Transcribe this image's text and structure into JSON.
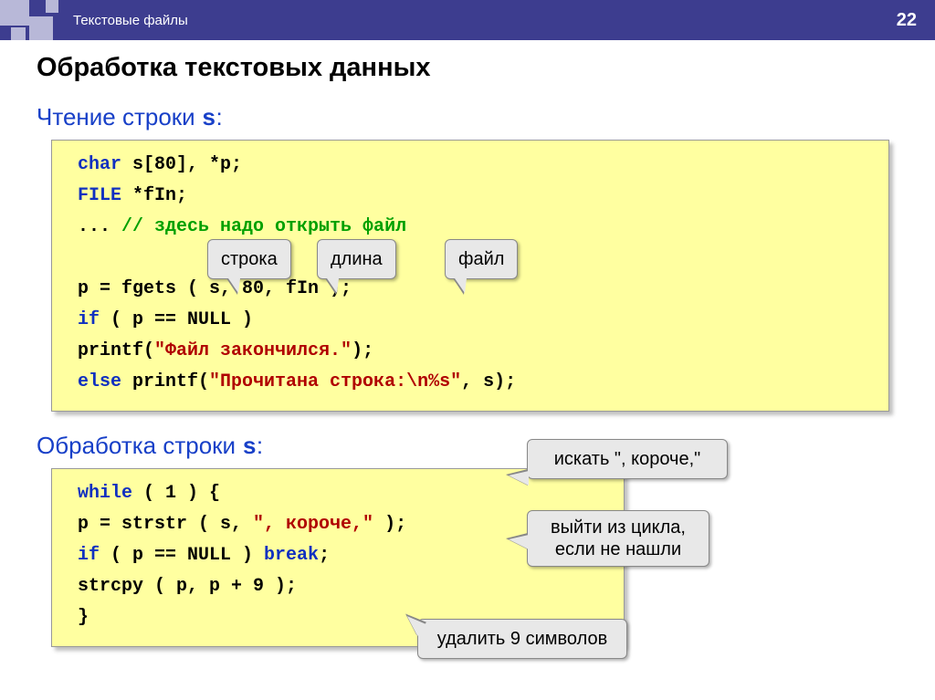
{
  "header": {
    "title": "Текстовые файлы",
    "page": "22"
  },
  "main_title": "Обработка текстовых данных",
  "section1": {
    "title_prefix": "Чтение строки ",
    "varname": "s",
    "title_suffix": ":",
    "code": {
      "l1a": "char",
      "l1b": " s[80], *p;",
      "l2a": "FILE",
      "l2b": " *fIn;",
      "l3a": "... ",
      "l3b": "// здесь надо открыть файл",
      "l4": "p = fgets ( s, 80, fIn );",
      "l5a": "if",
      "l5b": " ( p == NULL )",
      "l6a": "     printf(",
      "l6b": "\"Файл закончился.\"",
      "l6c": ");",
      "l7a": "else",
      "l7b": " printf(",
      "l7c": "\"Прочитана строка:\\n%s\"",
      "l7d": ", s);"
    },
    "callouts": {
      "stroka": "строка",
      "dlina": "длина",
      "file": "файл"
    }
  },
  "section2": {
    "title_prefix": "Обработка строки ",
    "varname": "s",
    "title_suffix": ":",
    "code": {
      "l1a": "while",
      "l1b": " ( 1 ) {",
      "l2a": "  p = strstr ( s, ",
      "l2b": "\", короче,\"",
      "l2c": " );",
      "l3a": "  if",
      "l3b": " ( p == NULL ) ",
      "l3c": "break",
      "l3d": ";",
      "l4": "  strcpy ( p, p + 9 );",
      "l5": "}"
    },
    "callouts": {
      "search": "искать \", короче,\"",
      "exit1": "выйти из цикла,",
      "exit2": "если не нашли",
      "delete": "удалить 9 символов"
    }
  }
}
